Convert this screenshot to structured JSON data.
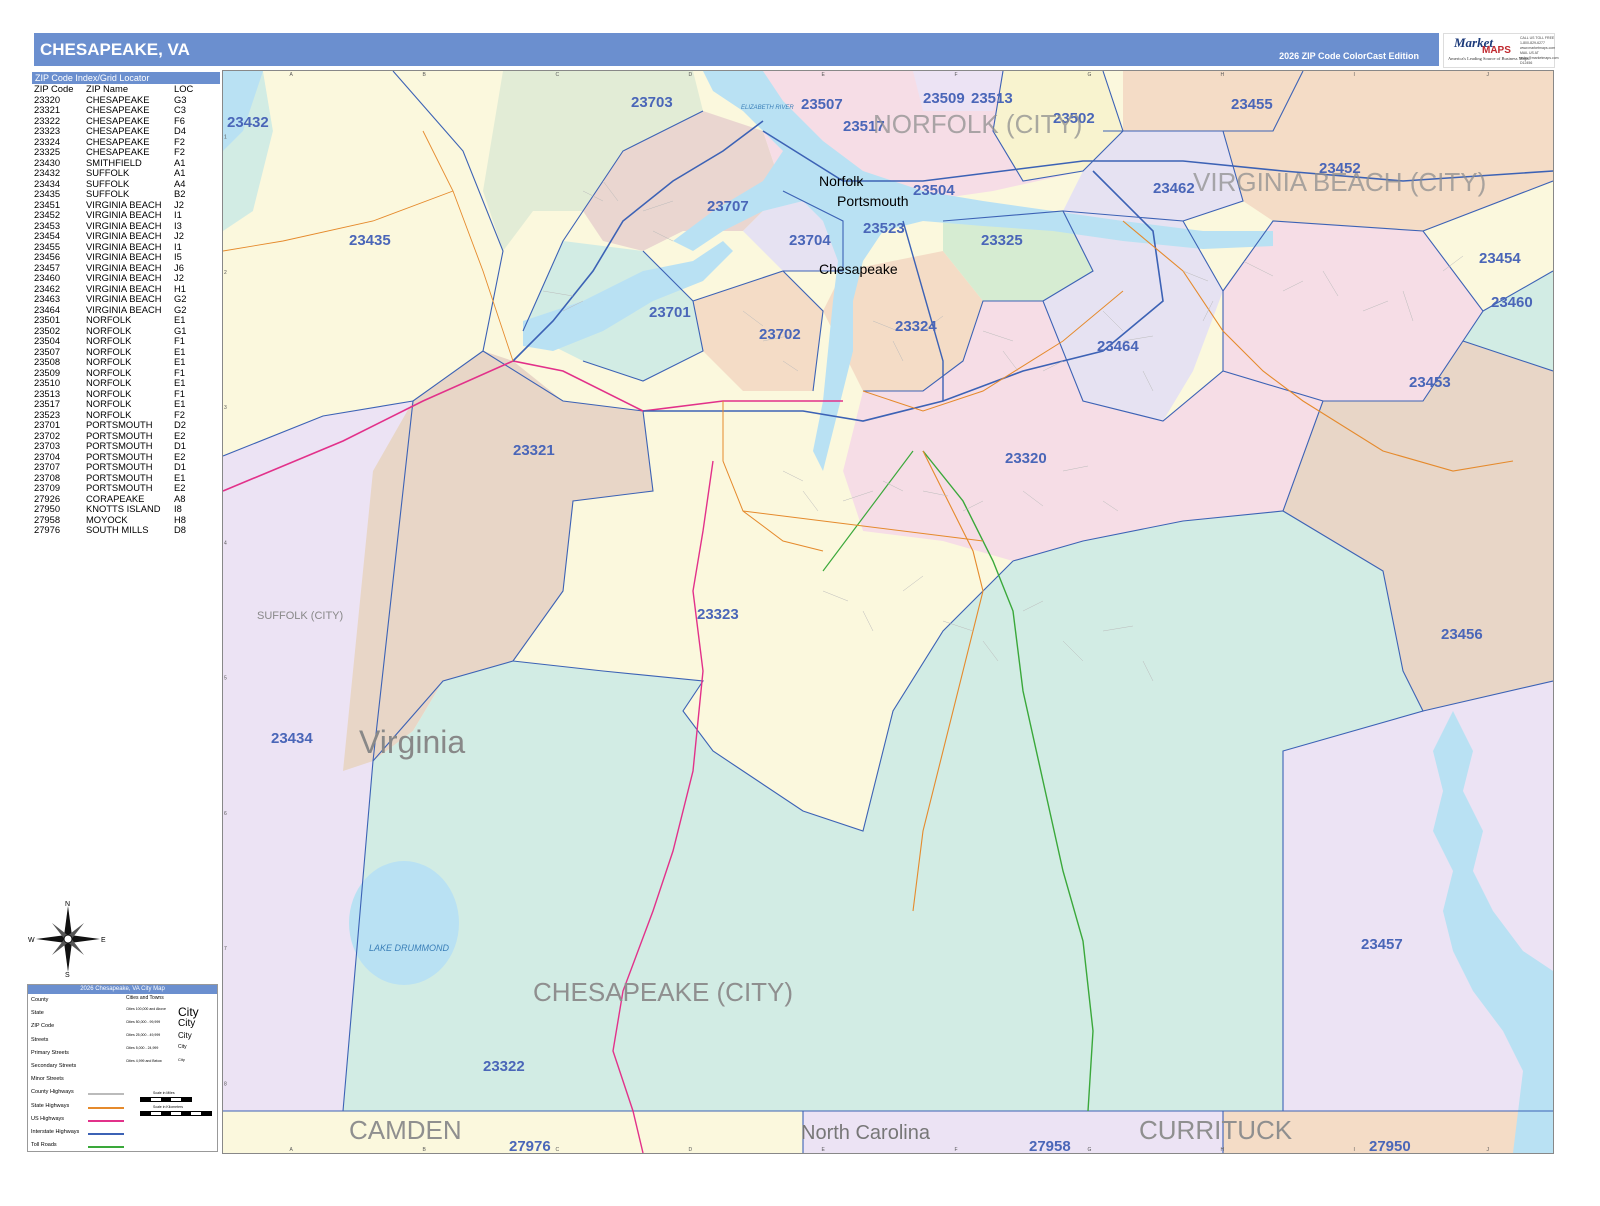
{
  "header": {
    "title": "CHESAPEAKE, VA",
    "edition": "2026 ZIP Code ColorCast Edition"
  },
  "logo": {
    "brand_top": "Market",
    "brand_bottom": "MAPS",
    "tagline": "America's Leading Source of Business Maps",
    "side_text": [
      "CALL US TOLL FREE",
      "1-800-829-6277",
      "www.marketmaps.com",
      "MAIL US AT",
      "sales@marketmaps.com",
      "D12456"
    ]
  },
  "zip_index": {
    "title": "ZIP Code Index/Grid Locator",
    "columns": [
      "ZIP Code",
      "ZIP Name",
      "LOC"
    ],
    "rows": [
      [
        "23320",
        "CHESAPEAKE",
        "G3"
      ],
      [
        "23321",
        "CHESAPEAKE",
        "C3"
      ],
      [
        "23322",
        "CHESAPEAKE",
        "F6"
      ],
      [
        "23323",
        "CHESAPEAKE",
        "D4"
      ],
      [
        "23324",
        "CHESAPEAKE",
        "F2"
      ],
      [
        "23325",
        "CHESAPEAKE",
        "F2"
      ],
      [
        "23430",
        "SMITHFIELD",
        "A1"
      ],
      [
        "23432",
        "SUFFOLK",
        "A1"
      ],
      [
        "23434",
        "SUFFOLK",
        "A4"
      ],
      [
        "23435",
        "SUFFOLK",
        "B2"
      ],
      [
        "23451",
        "VIRGINIA BEACH",
        "J2"
      ],
      [
        "23452",
        "VIRGINIA BEACH",
        "I1"
      ],
      [
        "23453",
        "VIRGINIA BEACH",
        "I3"
      ],
      [
        "23454",
        "VIRGINIA BEACH",
        "J2"
      ],
      [
        "23455",
        "VIRGINIA BEACH",
        "I1"
      ],
      [
        "23456",
        "VIRGINIA BEACH",
        "I5"
      ],
      [
        "23457",
        "VIRGINIA BEACH",
        "J6"
      ],
      [
        "23460",
        "VIRGINIA BEACH",
        "J2"
      ],
      [
        "23462",
        "VIRGINIA BEACH",
        "H1"
      ],
      [
        "23463",
        "VIRGINIA BEACH",
        "G2"
      ],
      [
        "23464",
        "VIRGINIA BEACH",
        "G2"
      ],
      [
        "23501",
        "NORFOLK",
        "E1"
      ],
      [
        "23502",
        "NORFOLK",
        "G1"
      ],
      [
        "23504",
        "NORFOLK",
        "F1"
      ],
      [
        "23507",
        "NORFOLK",
        "E1"
      ],
      [
        "23508",
        "NORFOLK",
        "E1"
      ],
      [
        "23509",
        "NORFOLK",
        "F1"
      ],
      [
        "23510",
        "NORFOLK",
        "E1"
      ],
      [
        "23513",
        "NORFOLK",
        "F1"
      ],
      [
        "23517",
        "NORFOLK",
        "E1"
      ],
      [
        "23523",
        "NORFOLK",
        "F2"
      ],
      [
        "23701",
        "PORTSMOUTH",
        "D2"
      ],
      [
        "23702",
        "PORTSMOUTH",
        "E2"
      ],
      [
        "23703",
        "PORTSMOUTH",
        "D1"
      ],
      [
        "23704",
        "PORTSMOUTH",
        "E2"
      ],
      [
        "23707",
        "PORTSMOUTH",
        "D1"
      ],
      [
        "23708",
        "PORTSMOUTH",
        "E1"
      ],
      [
        "23709",
        "PORTSMOUTH",
        "E2"
      ],
      [
        "27926",
        "CORAPEAKE",
        "A8"
      ],
      [
        "27950",
        "KNOTTS ISLAND",
        "I8"
      ],
      [
        "27958",
        "MOYOCK",
        "H8"
      ],
      [
        "27976",
        "SOUTH MILLS",
        "D8"
      ]
    ]
  },
  "compass": {
    "n": "N",
    "s": "S",
    "e": "E",
    "w": "W"
  },
  "legend": {
    "title": "2026 Chesapeake, VA City Map",
    "items": [
      "County",
      "State",
      "ZIP Code",
      "Streets",
      "Primary Streets",
      "Secondary Streets",
      "Minor Streets",
      "County Highways",
      "State Highways",
      "US Highways",
      "Interstate Highways",
      "Toll Roads"
    ],
    "cities_title": "Cities and Towns",
    "city_classes": [
      "Cities 100,000 and Above",
      "Cities 50,000 - 99,999",
      "Cities 25,000 - 49,999",
      "Cities 5,000 - 24,999",
      "Cities 4,999 and Below"
    ],
    "city_samples": [
      "City",
      "City",
      "City",
      "City",
      "City"
    ],
    "scale_miles": "Scale in Miles",
    "scale_km": "Scale in Kilometers"
  },
  "map": {
    "grid_columns": [
      "A",
      "B",
      "C",
      "D",
      "E",
      "F",
      "G",
      "H",
      "I",
      "J"
    ],
    "grid_rows": [
      "1",
      "2",
      "3",
      "4",
      "5",
      "6",
      "7",
      "8"
    ],
    "zip_labels": [
      {
        "text": "23703",
        "color": "#4a66b8"
      },
      {
        "text": "23509",
        "color": "#4a66b8"
      },
      {
        "text": "23513",
        "color": "#4a66b8"
      },
      {
        "text": "23502",
        "color": "#4a66b8"
      },
      {
        "text": "23455",
        "color": "#4a66b8"
      },
      {
        "text": "23432",
        "color": "#4a66b8"
      },
      {
        "text": "23507",
        "color": "#4a66b8"
      },
      {
        "text": "23517",
        "color": "#4a66b8"
      },
      {
        "text": "23452",
        "color": "#4a66b8"
      },
      {
        "text": "23707",
        "color": "#4a66b8"
      },
      {
        "text": "23504",
        "color": "#4a66b8"
      },
      {
        "text": "23462",
        "color": "#4a66b8"
      },
      {
        "text": "23435",
        "color": "#4a66b8"
      },
      {
        "text": "23704",
        "color": "#4a66b8"
      },
      {
        "text": "23523",
        "color": "#4a66b8"
      },
      {
        "text": "23325",
        "color": "#4a66b8"
      },
      {
        "text": "23454",
        "color": "#4a66b8"
      },
      {
        "text": "23460",
        "color": "#4a66b8"
      },
      {
        "text": "23701",
        "color": "#4a66b8"
      },
      {
        "text": "23702",
        "color": "#4a66b8"
      },
      {
        "text": "23324",
        "color": "#4a66b8"
      },
      {
        "text": "23464",
        "color": "#4a66b8"
      },
      {
        "text": "23453",
        "color": "#4a66b8"
      },
      {
        "text": "23321",
        "color": "#4a66b8"
      },
      {
        "text": "23320",
        "color": "#4a66b8"
      },
      {
        "text": "23323",
        "color": "#4a66b8"
      },
      {
        "text": "23456",
        "color": "#4a66b8"
      },
      {
        "text": "23434",
        "color": "#4a66b8"
      },
      {
        "text": "23457",
        "color": "#4a66b8"
      },
      {
        "text": "23322",
        "color": "#4a66b8"
      },
      {
        "text": "27976",
        "color": "#4a66b8"
      },
      {
        "text": "27958",
        "color": "#4a66b8"
      },
      {
        "text": "27950",
        "color": "#4a66b8"
      }
    ],
    "cities": [
      "Norfolk",
      "Portsmouth",
      "Chesapeake"
    ],
    "regions": [
      "NORFOLK (CITY)",
      "VIRGINIA BEACH (CITY)",
      "SUFFOLK (CITY)",
      "CHESAPEAKE (CITY)",
      "Virginia",
      "CAMDEN",
      "North Carolina",
      "CURRITUCK"
    ],
    "water_labels": [
      "ELIZABETH RIVER",
      "LAKE DRUMMOND"
    ],
    "colors": {
      "water": "#b9e1f3",
      "suffolk_purple": "#ece3f4",
      "tan": "#e8d6c7",
      "cream": "#fbf8dd",
      "mint": "#d2ece4",
      "pink": "#f6dde6",
      "lavender": "#e6e2f2",
      "peach": "#f4dcc6",
      "yellow": "#f8f3cf",
      "green": "#d6ecd2",
      "zip_boundary": "#3c62b5",
      "highway_pink": "#e2318a",
      "road_orange": "#e58a2c",
      "highway_green": "#3aa83a"
    }
  }
}
